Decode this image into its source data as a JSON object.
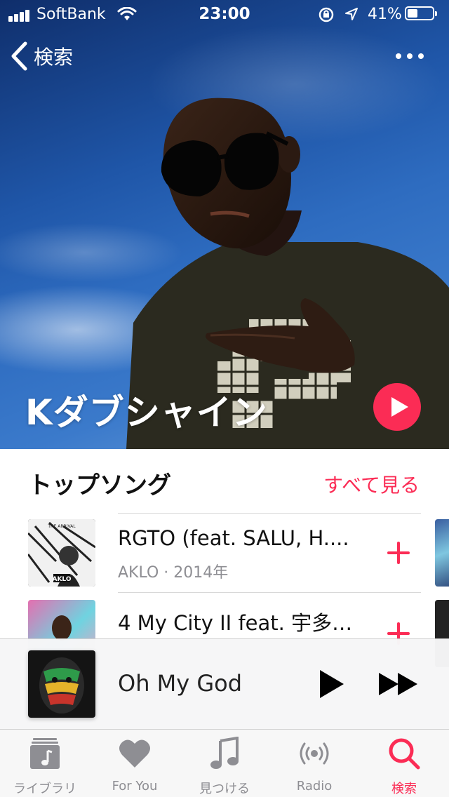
{
  "status_bar": {
    "carrier": "SoftBank",
    "time": "23:00",
    "battery_percent": "41%",
    "battery_level": 0.41
  },
  "nav": {
    "back_label": "検索"
  },
  "artist": {
    "name": "Kダブシャイン"
  },
  "top_songs": {
    "title": "トップソング",
    "see_all": "すべて見る",
    "songs": [
      {
        "title": "RGTO (feat. SALU, H....",
        "subtitle": "AKLO · 2014年",
        "art_text": "AKLO",
        "art_caption": "THE ARRIVAL"
      },
      {
        "title": "4 My City II feat. 宇多…",
        "subtitle": "",
        "art_text": "",
        "art_caption": ""
      }
    ]
  },
  "now_playing": {
    "title": "Oh My God"
  },
  "tab_bar": {
    "items": [
      {
        "label": "ライブラリ",
        "icon": "library-icon",
        "active": false
      },
      {
        "label": "For You",
        "icon": "heart-icon",
        "active": false
      },
      {
        "label": "見つける",
        "icon": "music-note-icon",
        "active": false
      },
      {
        "label": "Radio",
        "icon": "radio-icon",
        "active": false
      },
      {
        "label": "検索",
        "icon": "search-icon",
        "active": true
      }
    ]
  },
  "colors": {
    "accent": "#fb2c55",
    "secondary_text": "#8e8e93"
  }
}
